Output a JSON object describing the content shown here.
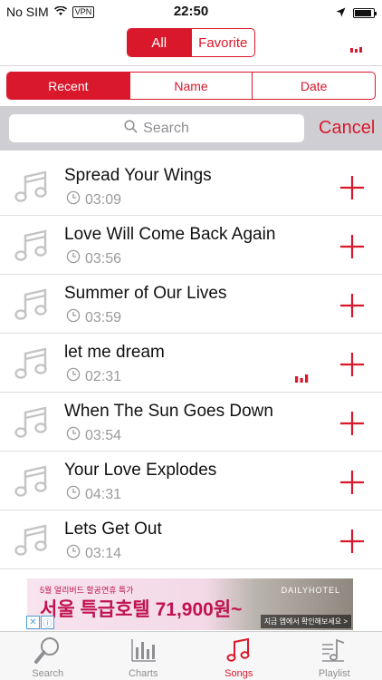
{
  "status": {
    "carrier": "No SIM",
    "vpn": "VPN",
    "time": "22:50",
    "battery_level": 0.9
  },
  "filter_tabs": [
    {
      "label": "All",
      "active": true
    },
    {
      "label": "Favorite",
      "active": false
    }
  ],
  "sort_tabs": [
    {
      "label": "Recent",
      "active": true
    },
    {
      "label": "Name",
      "active": false
    },
    {
      "label": "Date",
      "active": false
    }
  ],
  "search": {
    "placeholder": "Search",
    "cancel_label": "Cancel"
  },
  "songs": [
    {
      "title": "Spread Your Wings",
      "duration": "03:09",
      "playing": false
    },
    {
      "title": "Love Will Come Back Again",
      "duration": "03:56",
      "playing": false
    },
    {
      "title": "Summer of Our Lives",
      "duration": "03:59",
      "playing": false
    },
    {
      "title": "let me dream",
      "duration": "02:31",
      "playing": true
    },
    {
      "title": "When The Sun Goes Down",
      "duration": "03:54",
      "playing": false
    },
    {
      "title": "Your Love Explodes",
      "duration": "04:31",
      "playing": false
    },
    {
      "title": "Lets Get Out",
      "duration": "03:14",
      "playing": false
    }
  ],
  "ad": {
    "line1": "5월 얼리버드 할공연휴 특가",
    "line2": "서울 특급호텔 71,900원~",
    "brand": "DAILYHOTEL",
    "cta": "지금 앱에서 확인해보세요 >"
  },
  "tabs": [
    {
      "label": "Search",
      "icon": "search-icon",
      "active": false
    },
    {
      "label": "Charts",
      "icon": "charts-icon",
      "active": false
    },
    {
      "label": "Songs",
      "icon": "music-note-icon",
      "active": true
    },
    {
      "label": "Playlist",
      "icon": "playlist-icon",
      "active": false
    }
  ],
  "colors": {
    "accent": "#d9182b",
    "muted": "#8e8e93"
  }
}
